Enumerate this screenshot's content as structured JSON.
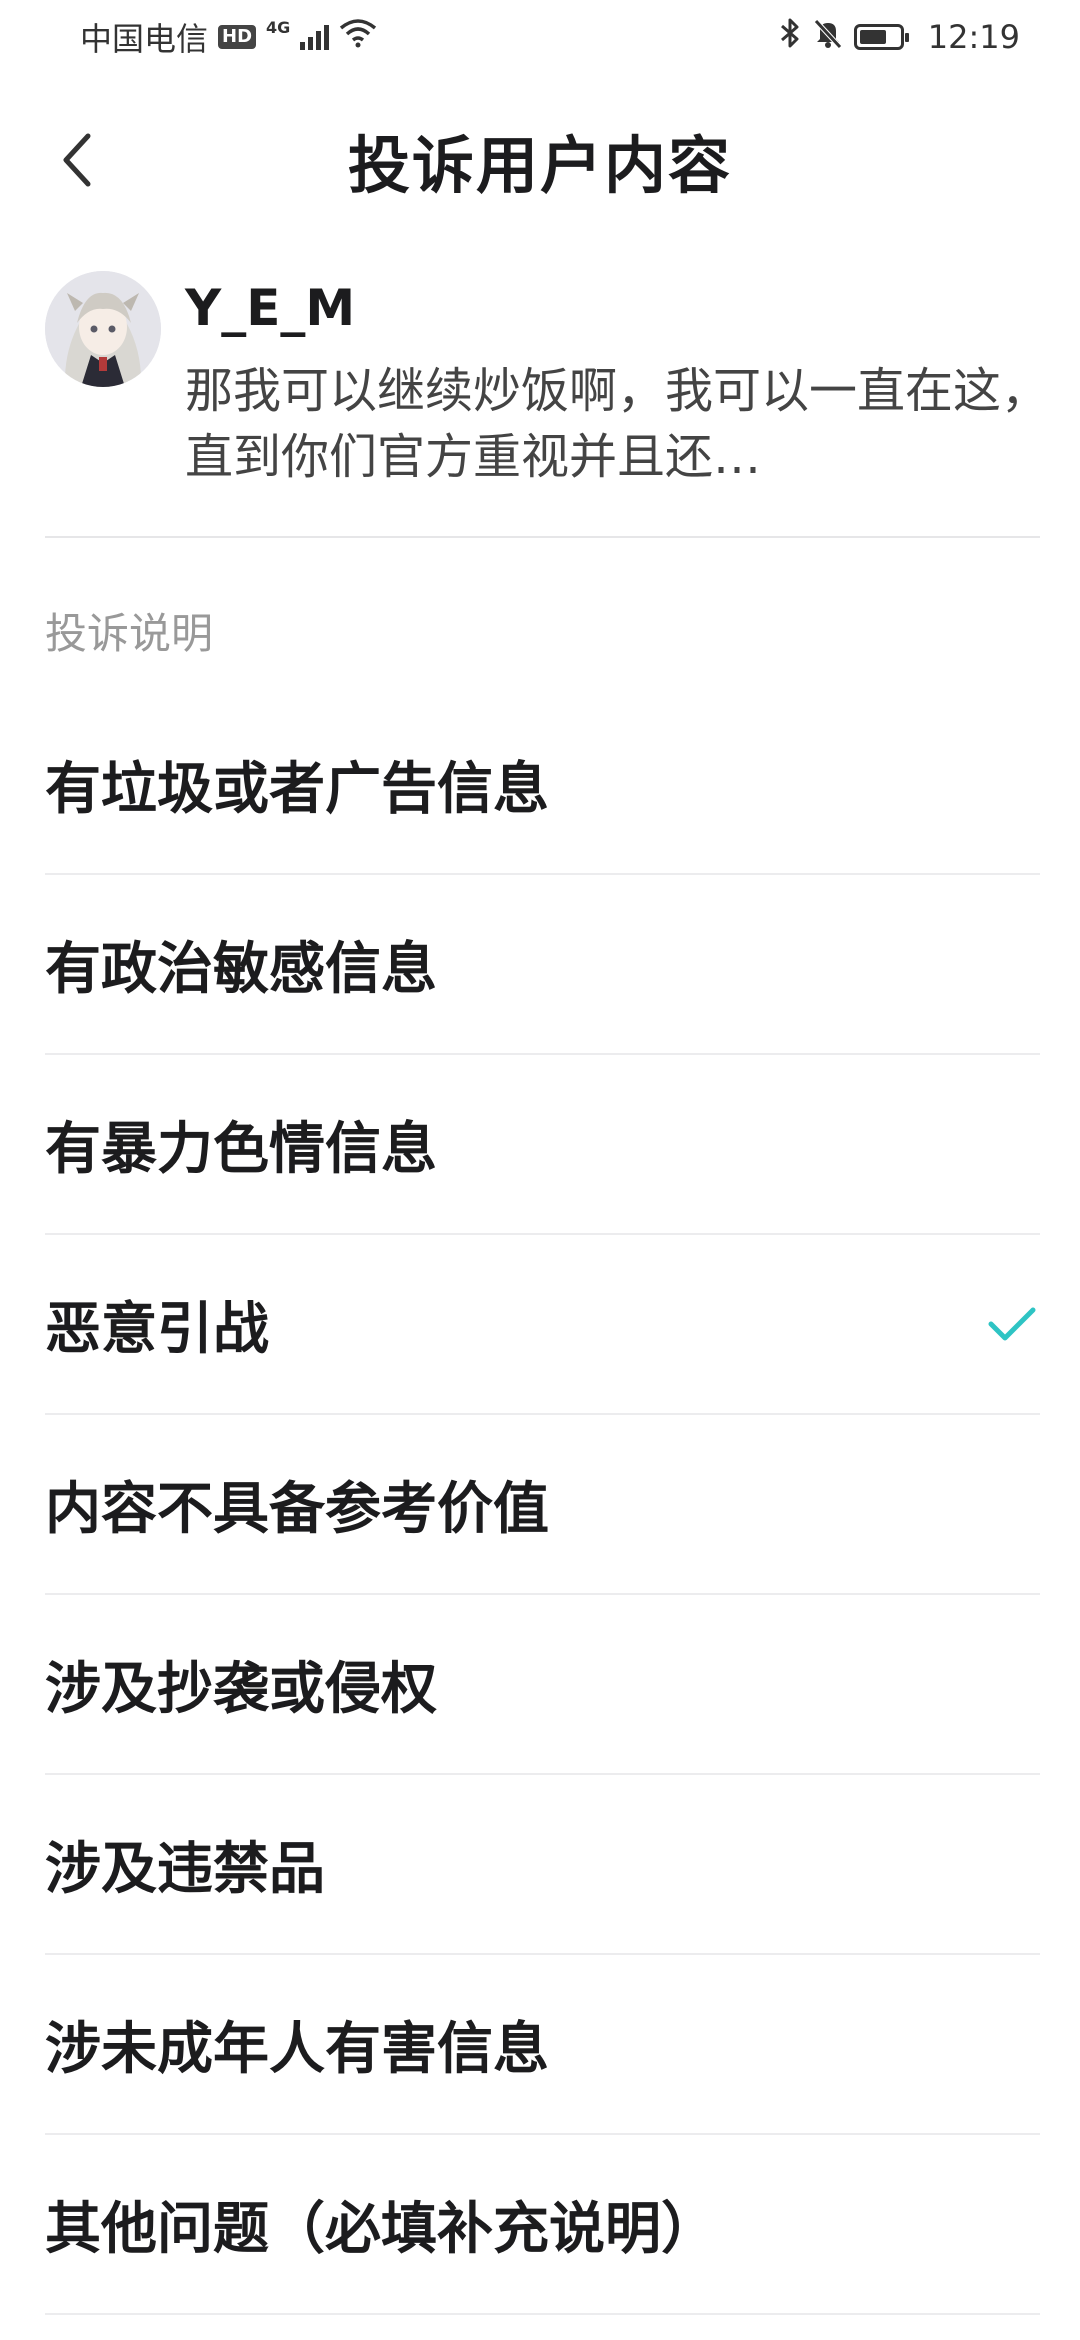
{
  "status_bar": {
    "carrier": "中国电信",
    "hd": "HD",
    "network": "4G",
    "time": "12:19"
  },
  "header": {
    "title": "投诉用户内容"
  },
  "reported": {
    "username": "Y_E_M",
    "excerpt": "那我可以继续炒饭啊，我可以一直在这，直到你们官方重视并且还…"
  },
  "section_label": "投诉说明",
  "options": [
    {
      "label": "有垃圾或者广告信息",
      "selected": false
    },
    {
      "label": "有政治敏感信息",
      "selected": false
    },
    {
      "label": "有暴力色情信息",
      "selected": false
    },
    {
      "label": "恶意引战",
      "selected": true
    },
    {
      "label": "内容不具备参考价值",
      "selected": false
    },
    {
      "label": "涉及抄袭或侵权",
      "selected": false
    },
    {
      "label": "涉及违禁品",
      "selected": false
    },
    {
      "label": "涉未成年人有害信息",
      "selected": false
    },
    {
      "label": "其他问题（必填补充说明）",
      "selected": false
    }
  ],
  "colors": {
    "accent": "#2EC4C4",
    "divider": "#ECECEE",
    "label_gray": "#999999"
  },
  "icons": [
    "back-arrow-icon",
    "bluetooth-icon",
    "mute-bell-icon",
    "battery-icon",
    "wifi-icon",
    "signal-icon",
    "check-icon"
  ]
}
